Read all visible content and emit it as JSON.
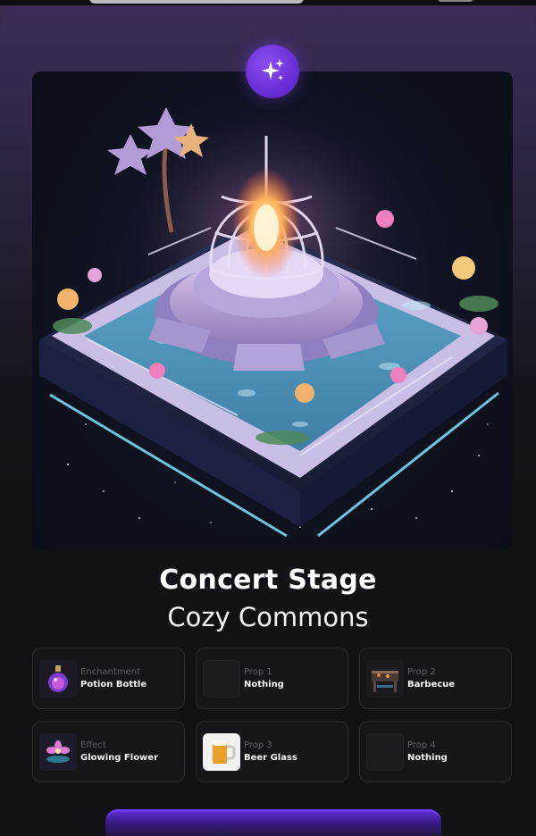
{
  "item": {
    "name": "Concert Stage",
    "collection": "Cozy Commons",
    "badge_icon": "sparkles-icon"
  },
  "slots": [
    {
      "category": "Enchantment",
      "value": "Potion Bottle",
      "icon": "potion-bottle-icon"
    },
    {
      "category": "Prop 1",
      "value": "Nothing",
      "icon": "empty-slot"
    },
    {
      "category": "Prop 2",
      "value": "Barbecue",
      "icon": "barbecue-icon"
    },
    {
      "category": "Effect",
      "value": "Glowing Flower",
      "icon": "glowing-flower-icon"
    },
    {
      "category": "Prop 3",
      "value": "Beer Glass",
      "icon": "beer-glass-icon"
    },
    {
      "category": "Prop 4",
      "value": "Nothing",
      "icon": "empty-slot"
    }
  ],
  "colors": {
    "accent": "#6a2ed6",
    "background": "#121216",
    "slot_border": "#2a2a31"
  }
}
